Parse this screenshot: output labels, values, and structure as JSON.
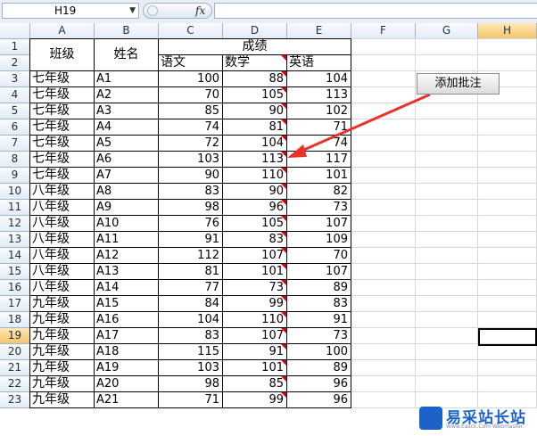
{
  "formula_bar": {
    "name_box": "H19",
    "fx_label": "fx",
    "formula": ""
  },
  "columns": [
    "A",
    "B",
    "C",
    "D",
    "E",
    "F",
    "G",
    "H"
  ],
  "selected_column": "H",
  "selected_row": 19,
  "rows": [
    1,
    2,
    3,
    4,
    5,
    6,
    7,
    8,
    9,
    10,
    11,
    12,
    13,
    14,
    15,
    16,
    17,
    18,
    19,
    20,
    21,
    22,
    23
  ],
  "header": {
    "class_label": "班级",
    "name_label": "姓名",
    "score_label": "成绩",
    "chinese": "语文",
    "math": "数学",
    "english": "英语"
  },
  "records": [
    {
      "class": "七年级",
      "name": "A1",
      "chinese": "100",
      "math": "88",
      "english": "104"
    },
    {
      "class": "七年级",
      "name": "A2",
      "chinese": "70",
      "math": "105",
      "english": "113"
    },
    {
      "class": "七年级",
      "name": "A3",
      "chinese": "85",
      "math": "90",
      "english": "102"
    },
    {
      "class": "七年级",
      "name": "A4",
      "chinese": "74",
      "math": "81",
      "english": "71"
    },
    {
      "class": "七年级",
      "name": "A5",
      "chinese": "72",
      "math": "104",
      "english": "74"
    },
    {
      "class": "七年级",
      "name": "A6",
      "chinese": "103",
      "math": "113",
      "english": "117"
    },
    {
      "class": "七年级",
      "name": "A7",
      "chinese": "90",
      "math": "110",
      "english": "101"
    },
    {
      "class": "八年级",
      "name": "A8",
      "chinese": "83",
      "math": "90",
      "english": "82"
    },
    {
      "class": "八年级",
      "name": "A9",
      "chinese": "98",
      "math": "96",
      "english": "73"
    },
    {
      "class": "八年级",
      "name": "A10",
      "chinese": "76",
      "math": "105",
      "english": "107"
    },
    {
      "class": "八年级",
      "name": "A11",
      "chinese": "91",
      "math": "83",
      "english": "109"
    },
    {
      "class": "八年级",
      "name": "A12",
      "chinese": "112",
      "math": "107",
      "english": "70"
    },
    {
      "class": "八年级",
      "name": "A13",
      "chinese": "81",
      "math": "101",
      "english": "107"
    },
    {
      "class": "八年级",
      "name": "A14",
      "chinese": "77",
      "math": "73",
      "english": "89"
    },
    {
      "class": "九年级",
      "name": "A15",
      "chinese": "84",
      "math": "99",
      "english": "83"
    },
    {
      "class": "九年级",
      "name": "A16",
      "chinese": "104",
      "math": "110",
      "english": "91"
    },
    {
      "class": "九年级",
      "name": "A17",
      "chinese": "83",
      "math": "107",
      "english": "73"
    },
    {
      "class": "九年级",
      "name": "A18",
      "chinese": "115",
      "math": "91",
      "english": "100"
    },
    {
      "class": "九年级",
      "name": "A19",
      "chinese": "103",
      "math": "101",
      "english": "89"
    },
    {
      "class": "九年级",
      "name": "A20",
      "chinese": "98",
      "math": "85",
      "english": "96"
    },
    {
      "class": "九年级",
      "name": "A21",
      "chinese": "71",
      "math": "99",
      "english": "96"
    }
  ],
  "add_comment_button": "添加批注",
  "annotation": {
    "arrow_color": "#e8332a",
    "comment_marker_color": "#e00000"
  },
  "watermark": {
    "text": "易采站长站",
    "sub": "Www.Easck.Com  Webmaster"
  },
  "colors": {
    "selected_header": "#f6c56a",
    "header_bg": "#e4ecf6"
  }
}
